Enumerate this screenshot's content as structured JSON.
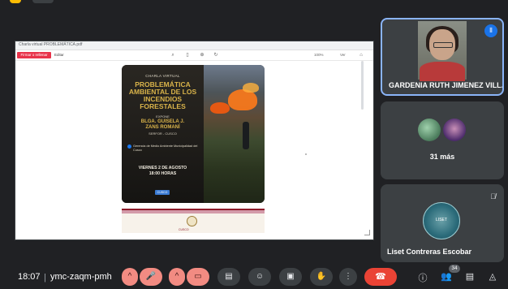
{
  "shared_screen": {
    "window_title": "Charla virtual PROBLEMÁTICA.pdf",
    "sign_button": "Firmar o rellenar",
    "toolbar_link": "Editar",
    "toolbar_zoom": "100%",
    "toolbar_right": "Ver",
    "poster": {
      "kicker": "CHARLA VIRTUAL",
      "title_lines": [
        "PROBLEMÁTICA",
        "AMBIENTAL DE LOS",
        "INCENDIOS",
        "FORESTALES"
      ],
      "exponent_label": "EXPONE",
      "speaker_lines": [
        "BLGA. GUISELA J.",
        "ZANS ROMANÍ"
      ],
      "speaker_org": "SERFOR - CUSCO",
      "fb_text": "Gerencia de Medio Ambiente Municipalidad del Cusco",
      "date_line": "VIERNES 2 DE AGOSTO",
      "time_line": "18:00 HORAS",
      "logo_text": "CUSCO"
    },
    "band_text": "CUSCO"
  },
  "participants": {
    "speaker_tile": {
      "name": "GARDENIA RUTH JIMENEZ VILL...",
      "speaking_icon": "audio-wave-icon"
    },
    "more_tile": {
      "label": "31 más"
    },
    "third_tile": {
      "name": "Liset Contreras Escobar",
      "avatar_text": "LISET",
      "mute_icon": "mic-off-icon"
    }
  },
  "meeting_bar": {
    "time": "18:07",
    "separator": "|",
    "code": "ymc-zaqm-pmh",
    "participant_count": "34",
    "controls": [
      {
        "name": "mic-options",
        "icon": "chevron-up-icon",
        "glyph": "^"
      },
      {
        "name": "mic",
        "icon": "mic-off-icon",
        "glyph": "🎤"
      },
      {
        "name": "cam-options",
        "icon": "chevron-up-icon",
        "glyph": "^"
      },
      {
        "name": "camera",
        "icon": "camera-off-icon",
        "glyph": "▭"
      },
      {
        "name": "captions",
        "icon": "captions-icon",
        "glyph": "▤"
      },
      {
        "name": "emoji",
        "icon": "emoji-icon",
        "glyph": "☺"
      },
      {
        "name": "present",
        "icon": "present-icon",
        "glyph": "▣"
      },
      {
        "name": "hand",
        "icon": "raise-hand-icon",
        "glyph": "✋"
      },
      {
        "name": "more",
        "icon": "more-vert-icon",
        "glyph": "⋮"
      }
    ],
    "end_call_glyph": "☎",
    "right_icons": {
      "info": "ⓘ",
      "people": "👥",
      "chat": "▤",
      "activities": "◬"
    }
  },
  "colors": {
    "accent_blue": "#8ab4f8",
    "end_call": "#ea4335",
    "muted_red": "#f28b82",
    "poster_gold": "#d9b34a"
  }
}
